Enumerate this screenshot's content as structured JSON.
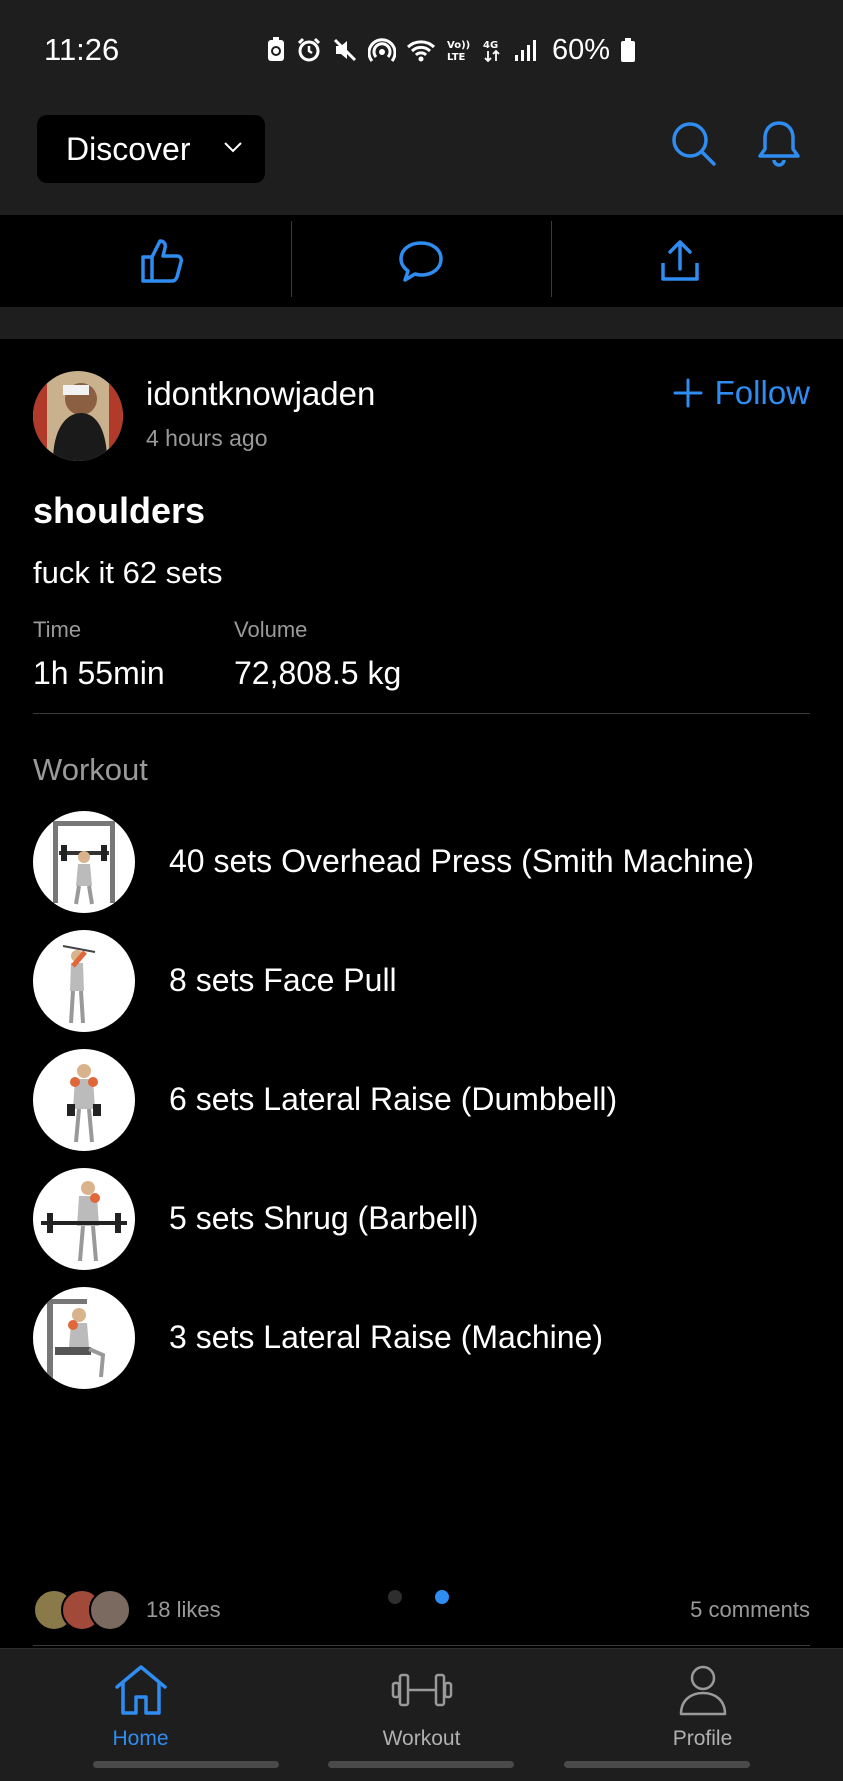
{
  "status": {
    "time": "11:26",
    "battery": "60%"
  },
  "header": {
    "feed_label": "Discover"
  },
  "post": {
    "username": "idontknowjaden",
    "time_ago": "4 hours ago",
    "follow_label": "Follow",
    "title": "shoulders",
    "description": "fuck it 62 sets",
    "stats": [
      {
        "label": "Time",
        "value": "1h 55min"
      },
      {
        "label": "Volume",
        "value": "72,808.5 kg"
      }
    ],
    "workout_label": "Workout",
    "exercises": [
      {
        "name": "40 sets Overhead Press (Smith Machine)"
      },
      {
        "name": "8 sets Face Pull"
      },
      {
        "name": "6 sets Lateral Raise (Dumbbell)"
      },
      {
        "name": "5 sets Shrug (Barbell)"
      },
      {
        "name": "3 sets Lateral Raise (Machine)"
      }
    ],
    "likes": "18 likes",
    "comments": "5 comments",
    "carousel": {
      "pages": 2,
      "active_page": 2
    }
  },
  "tabs": [
    {
      "label": "Home",
      "active": true
    },
    {
      "label": "Workout",
      "active": false
    },
    {
      "label": "Profile",
      "active": false
    }
  ],
  "colors": {
    "accent": "#2f8cf0",
    "background": "#000000",
    "surface": "#1e1e1e",
    "muted_text": "#9a9a9a"
  },
  "icons": [
    "thumbs-up-icon",
    "comment-icon",
    "share-icon",
    "search-icon",
    "bell-icon",
    "plus-icon",
    "chevron-down-icon",
    "home-icon",
    "dumbbell-icon",
    "profile-icon"
  ]
}
